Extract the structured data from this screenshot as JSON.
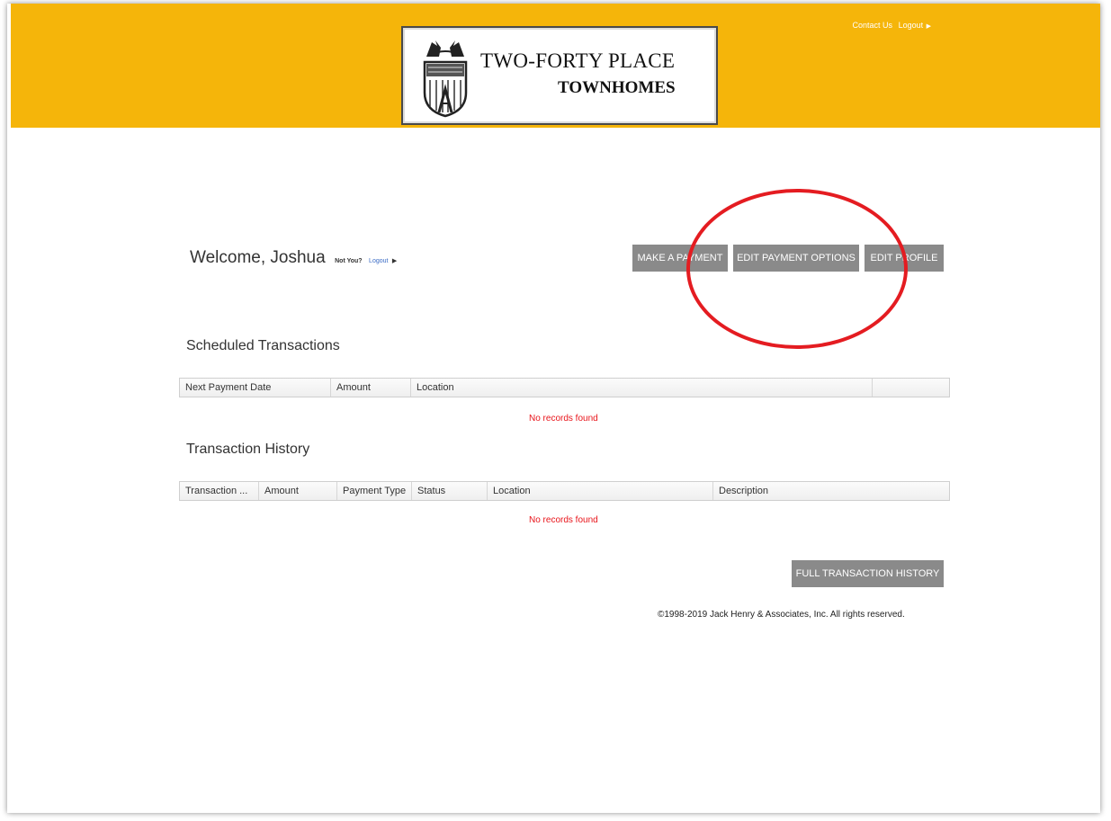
{
  "header": {
    "top_links": {
      "contact": "Contact Us",
      "logout": "Logout",
      "arrow": "▶"
    },
    "logo": {
      "line1": "TWO-FORTY PLACE",
      "line2": "TOWNHOMES"
    },
    "banner_color": "#f5b50a"
  },
  "welcome": {
    "greeting": "Welcome, Joshua",
    "not_you": "Not You?",
    "logout": "Logout",
    "arrow": "▶"
  },
  "actions": {
    "make_payment": "MAKE A PAYMENT",
    "edit_payment_options": "EDIT PAYMENT OPTIONS",
    "edit_profile": "EDIT PROFILE"
  },
  "scheduled": {
    "title": "Scheduled Transactions",
    "columns": [
      "Next Payment Date",
      "Amount",
      "Location",
      ""
    ],
    "empty_message": "No records found"
  },
  "history": {
    "title": "Transaction History",
    "columns": [
      "Transaction ...",
      "Amount",
      "Payment Type",
      "Status",
      "Location",
      "Description"
    ],
    "empty_message": "No records found",
    "full_history_button": "FULL TRANSACTION HISTORY"
  },
  "footer": {
    "copyright": "©1998-2019 Jack Henry & Associates, Inc. All rights reserved."
  },
  "colors": {
    "button": "#8a8a8a",
    "empty_text": "#e8141a",
    "annotation_circle": "#e41c21"
  }
}
